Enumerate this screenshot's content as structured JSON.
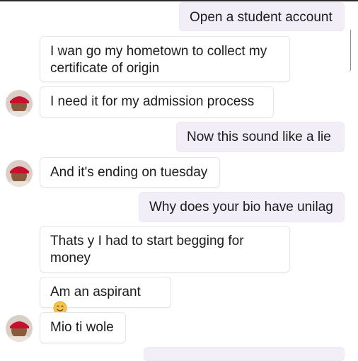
{
  "messages": [
    {
      "side": "sent",
      "text": "Open a student account"
    },
    {
      "side": "received",
      "text": "I wan go my hometown to collect my certificate of origin"
    },
    {
      "side": "received",
      "text": "I need it for my admission  process",
      "avatar": true
    },
    {
      "side": "sent",
      "text": "Now this sound like a lie"
    },
    {
      "side": "received",
      "text": "And it's ending on tuesday",
      "avatar": true
    },
    {
      "side": "sent",
      "text": "Why does your bio have unilag"
    },
    {
      "side": "received",
      "text": "Thats y I had to start begging  for money"
    },
    {
      "side": "received",
      "text": "Am an aspirant",
      "emoji": "smiling-face-icon"
    },
    {
      "side": "received",
      "text": "Mio ti wole",
      "avatar": true
    }
  ],
  "colors": {
    "sent_bubble": "#f1eef8",
    "received_bubble": "#ffffff",
    "avatar_cap": "#c8102e",
    "avatar_skin": "#8a5a3c"
  }
}
